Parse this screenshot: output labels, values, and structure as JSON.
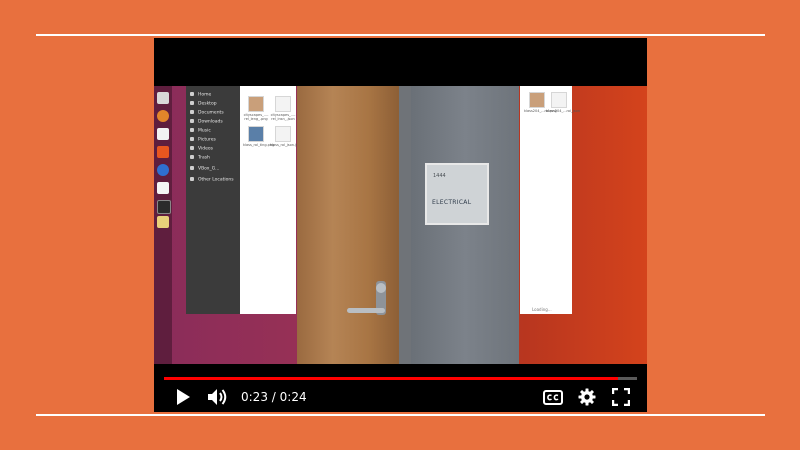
{
  "player": {
    "current_time": "0:23",
    "separator": "/",
    "duration": "0:24",
    "progress": 0.96,
    "colors": {
      "progress": "#ff0000",
      "background": "#000000",
      "page": "#e8703e"
    },
    "controls": {
      "play_icon": "play-icon",
      "volume_icon": "volume-icon",
      "captions_icon": "captions-icon",
      "settings_icon": "gear-icon",
      "fullscreen_icon": "fullscreen-icon"
    }
  },
  "video_frame": {
    "file_manager": {
      "sidebar_items": [
        "Home",
        "Desktop",
        "Documents",
        "Downloads",
        "Music",
        "Pictures",
        "Videos",
        "Trash",
        "VBox_G...",
        "Other Locations"
      ],
      "files": [
        {
          "name": "cityscapes_...-rel_leng_.png",
          "kind": "image"
        },
        {
          "name": "cityscapes_...-rel_insn_.json",
          "kind": "doc"
        },
        {
          "name": "klass_rol_ting.png",
          "kind": "blue"
        },
        {
          "name": "klass_rol_json.json",
          "kind": "doc"
        }
      ]
    },
    "right_window": {
      "files": [
        {
          "name": "klass204_...rol.png",
          "kind": "image"
        },
        {
          "name": "klass204_...rol_json",
          "kind": "doc"
        }
      ],
      "status": "Loading..."
    },
    "sign": {
      "room": "1444",
      "label": "ELECTRICAL"
    }
  }
}
